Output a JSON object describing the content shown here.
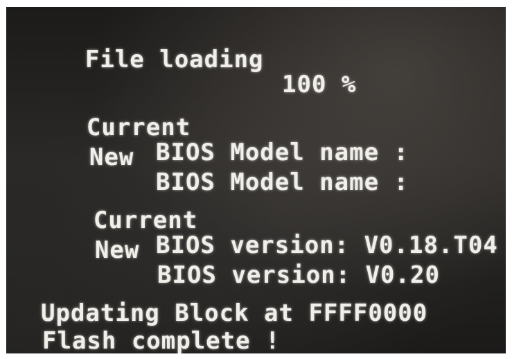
{
  "screen": {
    "file_loading": {
      "label": "File loading",
      "value": "100 %"
    },
    "model": {
      "current_prefix": "Current",
      "current_text": "BIOS Model name :",
      "new_prefix": "New",
      "new_text": "BIOS Model name :"
    },
    "version": {
      "current_prefix": "Current",
      "current_text": "BIOS version: V0.18.T04",
      "new_prefix": "New",
      "new_text": "BIOS version: V0.20"
    },
    "status": {
      "updating": "Updating Block at FFFF0000",
      "complete": "Flash complete !"
    }
  },
  "colors": {
    "text": "#f1efe9",
    "background": "#242321",
    "border": "#ffffff"
  }
}
